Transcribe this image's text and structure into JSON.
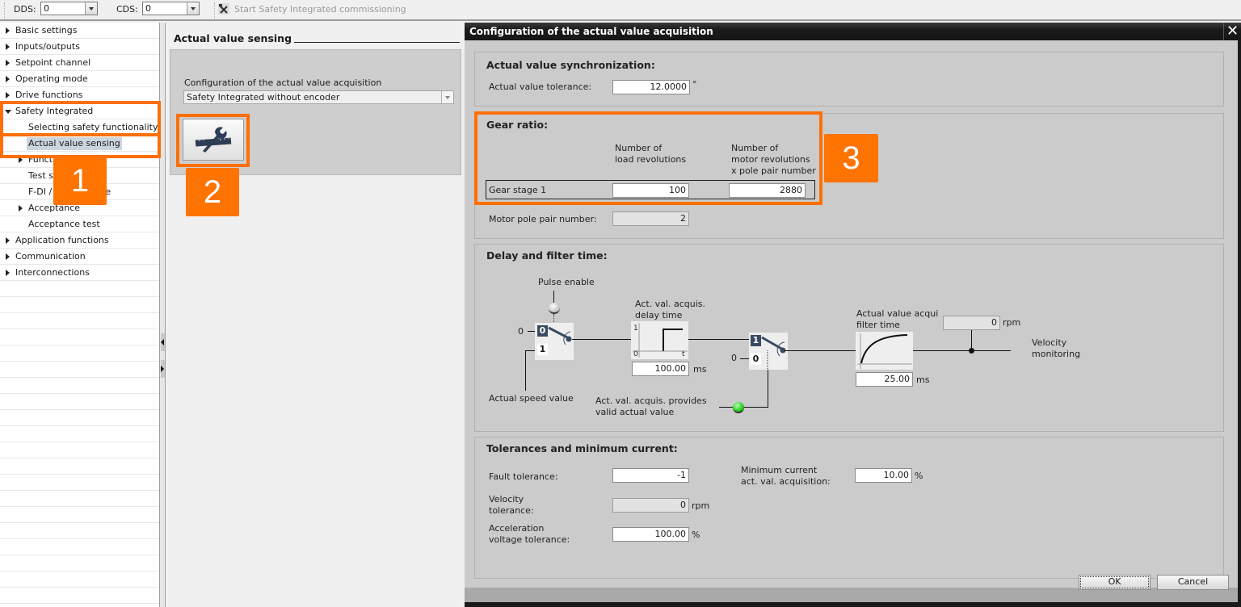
{
  "toolbar": {
    "dds_label": "DDS:",
    "dds_value": "0",
    "cds_label": "CDS:",
    "cds_value": "0",
    "start_commissioning": "Start Safety Integrated commissioning"
  },
  "tree": {
    "items": [
      {
        "label": "Basic settings",
        "level": 0,
        "expander": "closed"
      },
      {
        "label": "Inputs/outputs",
        "level": 0,
        "expander": "closed"
      },
      {
        "label": "Setpoint channel",
        "level": 0,
        "expander": "closed"
      },
      {
        "label": "Operating mode",
        "level": 0,
        "expander": "closed"
      },
      {
        "label": "Drive functions",
        "level": 0,
        "expander": "closed"
      },
      {
        "label": "Safety Integrated",
        "level": 0,
        "expander": "open"
      },
      {
        "label": "Selecting safety functionality",
        "level": 1,
        "expander": "none"
      },
      {
        "label": "Actual value sensing",
        "level": 1,
        "expander": "none",
        "selected": true
      },
      {
        "label": "Funct",
        "level": 1,
        "expander": "closed"
      },
      {
        "label": "Test s",
        "level": 1,
        "expander": "none"
      },
      {
        "label": "F-DI / F",
        "level": 1,
        "expander": "none",
        "trailing": "safe"
      },
      {
        "label": "Acceptance",
        "level": 1,
        "expander": "closed"
      },
      {
        "label": "Acceptance test",
        "level": 1,
        "expander": "none"
      },
      {
        "label": "Application functions",
        "level": 0,
        "expander": "closed"
      },
      {
        "label": "Communication",
        "level": 0,
        "expander": "closed"
      },
      {
        "label": "Interconnections",
        "level": 0,
        "expander": "closed"
      }
    ]
  },
  "editor": {
    "title": "Actual value sensing",
    "config_label": "Configuration of the actual value acquisition",
    "config_value": "Safety Integrated without encoder",
    "config_button_icon": "wrench-ruler-icon"
  },
  "callouts": {
    "one": "1",
    "two": "2",
    "three": "3",
    "color": "#ff7300"
  },
  "dialog": {
    "title": "Configuration of the actual value acquisition",
    "sync": {
      "title": "Actual value synchronization:",
      "tolerance_label": "Actual value tolerance:",
      "tolerance_value": "12.0000",
      "tolerance_unit": "°"
    },
    "gear": {
      "title": "Gear ratio:",
      "col_load_1": "Number of",
      "col_load_2": "load revolutions",
      "col_motor_1": "Number of",
      "col_motor_2": "motor revolutions",
      "col_motor_3": "x pole pair number",
      "stage_label": "Gear stage 1",
      "load_revolutions": "100",
      "motor_revolutions": "2880",
      "pole_pair_label": "Motor pole pair number:",
      "pole_pair_value": "2"
    },
    "delay": {
      "title": "Delay and filter time:",
      "pulse_enable": "Pulse enable",
      "sw1_zero": "0",
      "sw1_one": "1",
      "sw1_input_zero": "0",
      "actual_speed": "Actual speed value",
      "delay_label_1": "Act. val. acquis.",
      "delay_label_2": "delay time",
      "delay_axis_1": "1",
      "delay_axis_0": "0",
      "delay_axis_t": "t",
      "delay_value": "100.00",
      "delay_unit": "ms",
      "sw2_one": "1",
      "sw2_zero": "0",
      "sw2_input_zero": "0",
      "valid_label_1": "Act. val. acquis. provides",
      "valid_label_2": "valid actual value",
      "filter_label_1": "Actual value acqui",
      "filter_label_2": "filter time",
      "filter_value": "25.00",
      "filter_unit": "ms",
      "speed_value": "0",
      "speed_unit": "rpm",
      "velocity_1": "Velocity",
      "velocity_2": "monitoring",
      "led_valid_color": "#22cc22",
      "led_pulse_color": "#e8e8e8"
    },
    "tol": {
      "title": "Tolerances and minimum current:",
      "fault_label": "Fault tolerance:",
      "fault_value": "-1",
      "velocity_label_1": "Velocity",
      "velocity_label_2": "tolerance:",
      "velocity_value": "0",
      "velocity_unit": "rpm",
      "accel_label_1": "Acceleration",
      "accel_label_2": "voltage tolerance:",
      "accel_value": "100.00",
      "accel_unit": "%",
      "mincur_label_1": "Minimum current",
      "mincur_label_2": "act. val. acquisition:",
      "mincur_value": "10.00",
      "mincur_unit": "%"
    },
    "ok": "OK",
    "cancel": "Cancel"
  }
}
